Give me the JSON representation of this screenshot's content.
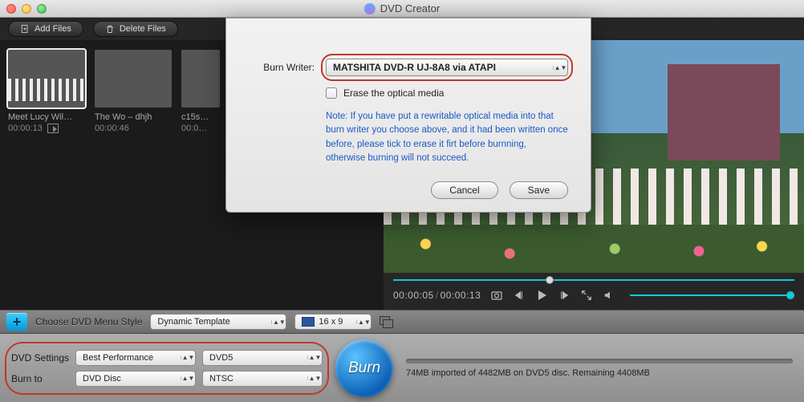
{
  "app": {
    "title": "DVD Creator"
  },
  "toolbar": {
    "add_files": "Add Files",
    "delete_files": "Delete Files"
  },
  "thumbs": [
    {
      "title": "Meet Lucy Wil…",
      "duration": "00:00:13",
      "selected": true,
      "editable": true
    },
    {
      "title": "The Wo – dhjh",
      "duration": "00:00:46",
      "selected": false,
      "editable": false
    },
    {
      "title": "c15s…",
      "duration": "00:0…",
      "selected": false,
      "editable": false
    }
  ],
  "modal": {
    "burn_writer_label": "Burn Writer:",
    "burn_writer_value": "MATSHITA DVD-R   UJ-8A8 via ATAPI",
    "erase_label": "Erase the optical media",
    "note": "Note: If you have put a rewritable optical media into that burn writer you choose above, and it had been written once before, please tick to erase it firt before burnning, otherwise burning will not succeed.",
    "cancel": "Cancel",
    "save": "Save"
  },
  "preview": {
    "position": "00:00:05",
    "duration": "00:00:13",
    "seek_percent": 38,
    "volume_percent": 100
  },
  "menubar": {
    "choose_label": "Choose DVD Menu Style",
    "template": "Dynamic Template",
    "aspect": "16 x 9"
  },
  "settings": {
    "dvd_settings_label": "DVD Settings",
    "burn_to_label": "Burn to",
    "quality": "Best Performance",
    "disc_type": "DVD5",
    "target": "DVD Disc",
    "standard": "NTSC"
  },
  "burn": {
    "label": "Burn"
  },
  "status": {
    "text": "74MB imported of 4482MB on DVD5 disc. Remaining 4408MB"
  }
}
